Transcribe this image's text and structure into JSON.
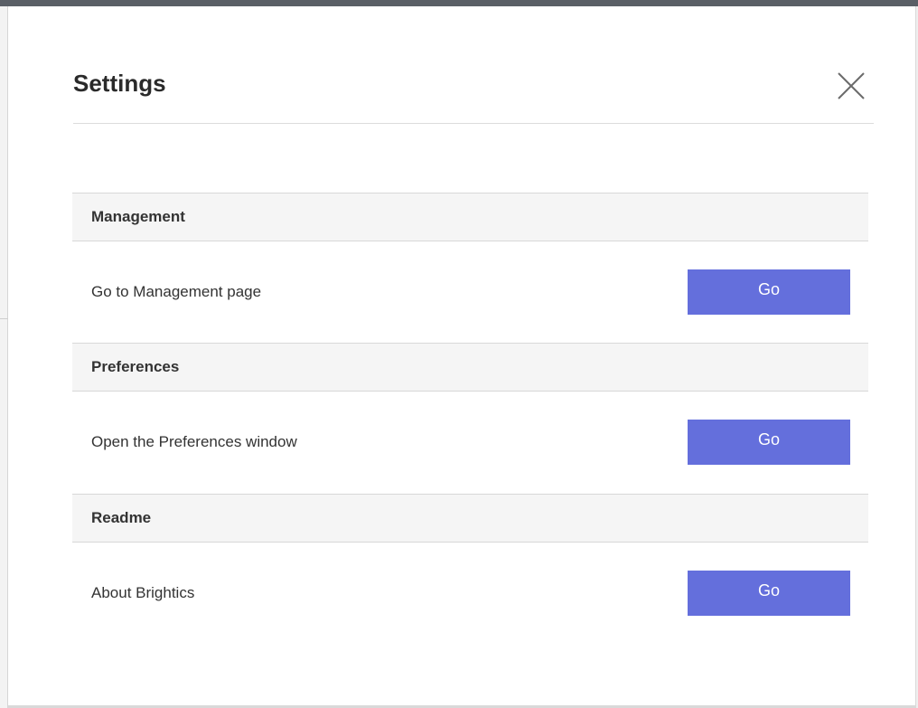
{
  "dialog": {
    "title": "Settings",
    "close_icon": "close-icon"
  },
  "sections": [
    {
      "header": "Management",
      "row_label": "Go to Management page",
      "button_label": "Go"
    },
    {
      "header": "Preferences",
      "row_label": "Open the Preferences window",
      "button_label": "Go"
    },
    {
      "header": "Readme",
      "row_label": "About Brightics",
      "button_label": "Go"
    }
  ],
  "colors": {
    "button": "#646fdc",
    "section_header_bg": "#f5f5f5",
    "top_bar": "#5a5f66"
  }
}
